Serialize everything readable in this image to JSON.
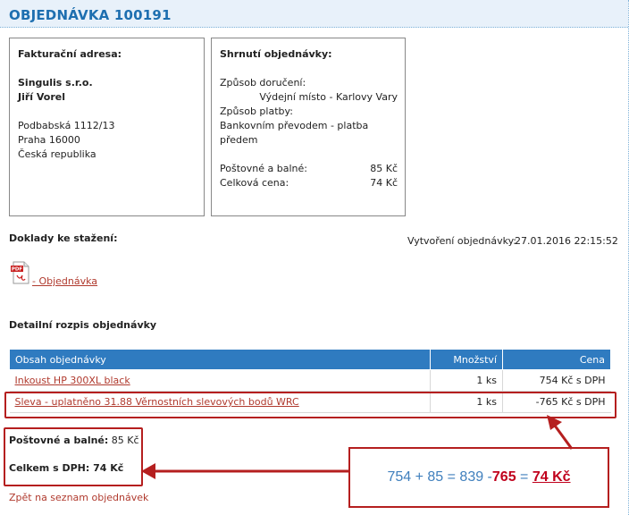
{
  "page": {
    "title": "OBJEDNÁVKA 100191"
  },
  "billing": {
    "heading": "Fakturační adresa:",
    "company": "Singulis s.r.o.",
    "person": "Jiří Vorel",
    "street": "Podbabská 1112/13",
    "city": "Praha 16000",
    "country": "Česká republika"
  },
  "summary": {
    "heading": "Shrnutí objednávky:",
    "delivery_label": "Způsob doručení:",
    "delivery_value": "Výdejní místo - Karlovy Vary",
    "payment_label": "Způsob platby:",
    "payment_value_line1": "Bankovním převodem - platba",
    "payment_value_line2": "předem",
    "shipping_label": "Poštovné a balné:",
    "shipping_value": "85 Kč",
    "total_label": "Celková cena:",
    "total_value": "74 Kč"
  },
  "documents": {
    "heading": "Doklady ke stažení:",
    "created_label": "Vytvoření objednávky:",
    "created_value": "27.01.2016 22:15:52",
    "pdf_icon_text": "PDF",
    "pdf_link": " - Objednávka"
  },
  "details": {
    "heading": "Detailní rozpis objednávky",
    "columns": [
      "Obsah objednávky",
      "Množství",
      "Cena"
    ],
    "rows": [
      {
        "name": "Inkoust HP 300XL black",
        "qty": "1 ks",
        "price": "754 Kč s DPH"
      },
      {
        "name": "Sleva - uplatněno 31.88 Věrnostních slevových bodů WRC",
        "qty": "1 ks",
        "price": "-765 Kč s DPH"
      }
    ]
  },
  "totals": {
    "shipping_label": "Poštovné a balné:",
    "shipping_value": " 85 Kč",
    "total_label": "Celkem s DPH:",
    "total_value": " 74 Kč"
  },
  "back_link": "Zpět na seznam objednávek",
  "annotation": {
    "part1": "754 + 85 = 839 - ",
    "part2": "765",
    "part3": " = ",
    "part4": "74 Kč"
  },
  "colors": {
    "accent": "#1e6fb0",
    "table_header": "#2f7bc0",
    "highlight": "#b51f1f",
    "link": "#b03a2e"
  }
}
